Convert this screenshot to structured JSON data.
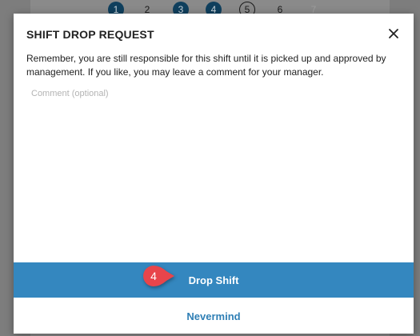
{
  "background": {
    "calendar_days": [
      {
        "label": "1",
        "style": "filled"
      },
      {
        "label": "2",
        "style": "plain"
      },
      {
        "label": "3",
        "style": "filled"
      },
      {
        "label": "4",
        "style": "filled"
      },
      {
        "label": "5",
        "style": "outlined"
      },
      {
        "label": "6",
        "style": "plain"
      },
      {
        "label": "7",
        "style": "faded"
      }
    ]
  },
  "modal": {
    "title": "SHIFT DROP REQUEST",
    "close_icon": "close-icon",
    "message": "Remember, you are still responsible for this shift until it is picked up and approved by management. If you like, you may leave a comment for your manager.",
    "comment": {
      "value": "",
      "placeholder": "Comment (optional)"
    },
    "primary_button_label": "Drop Shift",
    "secondary_button_label": "Nevermind"
  },
  "step_marker": {
    "number": "4",
    "color": "#e8454b"
  },
  "colors": {
    "primary_button": "#3487bf",
    "link_text": "#2f7fb5",
    "day_filled": "#0f3f5d"
  }
}
